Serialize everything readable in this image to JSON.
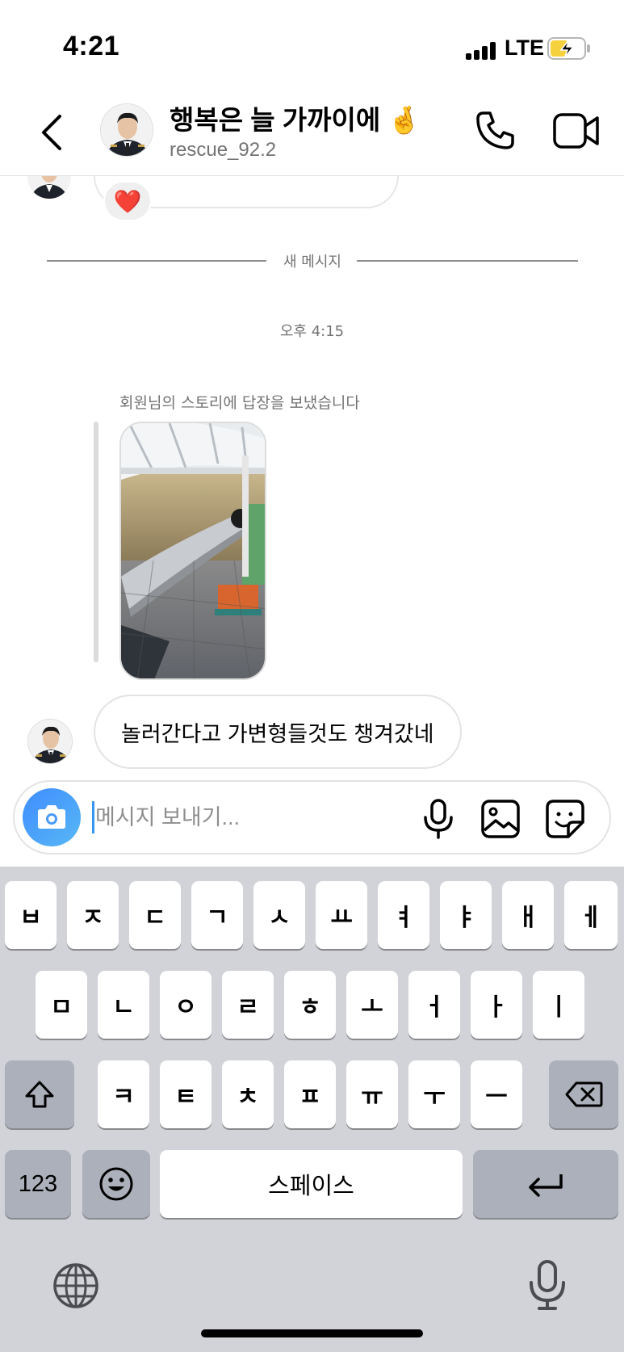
{
  "status_bar": {
    "time": "4:21",
    "network": "LTE"
  },
  "header": {
    "display_name": "행복은 늘 가까이에 🤞",
    "username": "rescue_92.2"
  },
  "chat": {
    "reaction": "❤️",
    "new_messages_divider": "새 메시지",
    "timestamp": "오후 4:15",
    "story_reply_label": "회원님의 스토리에 답장을 보냈습니다",
    "message_text": "놀러간다고 가변형들것도 챙겨갔네"
  },
  "composer": {
    "placeholder": "메시지 보내기..."
  },
  "keyboard": {
    "row1": [
      "ㅂ",
      "ㅈ",
      "ㄷ",
      "ㄱ",
      "ㅅ",
      "ㅛ",
      "ㅕ",
      "ㅑ",
      "ㅐ",
      "ㅔ"
    ],
    "row2": [
      "ㅁ",
      "ㄴ",
      "ㅇ",
      "ㄹ",
      "ㅎ",
      "ㅗ",
      "ㅓ",
      "ㅏ",
      "ㅣ"
    ],
    "row3": [
      "ㅋ",
      "ㅌ",
      "ㅊ",
      "ㅍ",
      "ㅠ",
      "ㅜ",
      "ㅡ"
    ],
    "numbers_label": "123",
    "space_label": "스페이스"
  },
  "colors": {
    "accent": "#3797f0",
    "camera_gradient_start": "#3f8cff",
    "camera_gradient_end": "#58b8f5",
    "battery_fill": "#f5d13d"
  }
}
